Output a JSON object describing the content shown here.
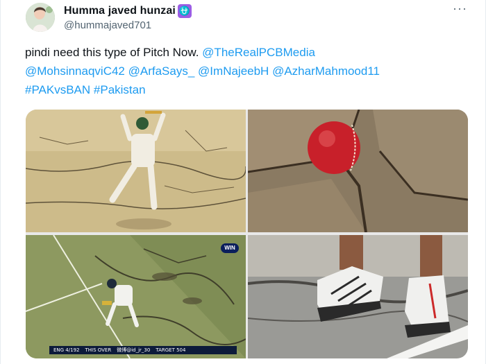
{
  "author": {
    "display_name": "Humma javed hunzai",
    "badge": "⛎",
    "handle": "@hummajaved701"
  },
  "menu_icon": "···",
  "text": {
    "plain": "pindi need this type of Pitch Now.",
    "mentions": [
      "@TheRealPCBMedia",
      "@MohsinnaqviC42",
      "@ArfaSays_",
      "@ImNajeebH",
      "@AzharMahmood11"
    ],
    "hashtags": [
      "#PAKvsBAN",
      "#Pakistan"
    ]
  },
  "media": {
    "tile3_logo": "WIN",
    "tile3_score": "ENG 4/192",
    "tile3_over": "THIS OVER",
    "tile3_watermark": "微博@id_jr_30",
    "tile3_target": "TARGET 504"
  },
  "colors": {
    "link": "#1d9bf0",
    "muted": "#536471"
  }
}
